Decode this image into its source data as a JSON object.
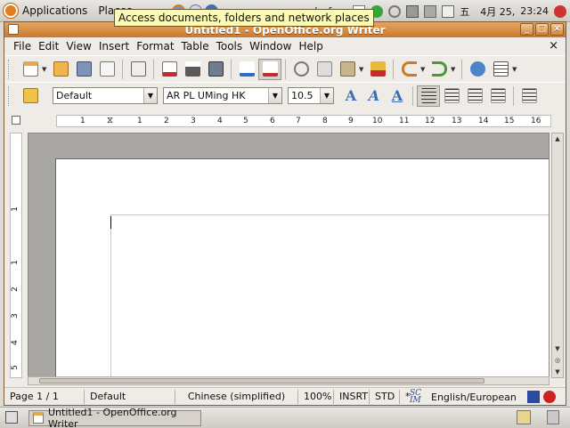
{
  "top_panel": {
    "applications_label": "Applications",
    "places_label": "Places",
    "tooltip": "Access documents, folders and network places",
    "user_name": "sdccf",
    "ime_char": "五",
    "date": "4月 25,",
    "time": "23:24"
  },
  "window": {
    "title": "Untitled1 - OpenOffice.org Writer"
  },
  "menubar": {
    "items": [
      "File",
      "Edit",
      "View",
      "Insert",
      "Format",
      "Table",
      "Tools",
      "Window",
      "Help"
    ],
    "close_glyph": "×"
  },
  "format_toolbar": {
    "paragraph_style": "Default",
    "font_name": "AR PL UMing HK",
    "font_size": "10.5",
    "bold_letter": "A",
    "italic_letter": "A",
    "underline_letter": "A"
  },
  "ruler": {
    "numbers": [
      "1",
      "1",
      "2",
      "3",
      "4",
      "5",
      "6",
      "7",
      "8",
      "9",
      "10",
      "11",
      "12",
      "13",
      "14",
      "15",
      "16"
    ],
    "vertical_numbers": [
      "1",
      "1",
      "2",
      "3",
      "4",
      "5"
    ]
  },
  "statusbar": {
    "page": "Page 1 / 1",
    "style": "Default",
    "language": "Chinese (simplified)",
    "zoom": "100%",
    "insert_mode": "INSRT",
    "selection_mode": "STD",
    "modified": "*",
    "input_method_label": "English/European"
  },
  "bottom_panel": {
    "task_label": "Untitled1 - OpenOffice.org Writer"
  },
  "colors": {
    "titlebar": "#d18a45",
    "panel": "#dcdad5",
    "accent_orange": "#e07d1d"
  }
}
